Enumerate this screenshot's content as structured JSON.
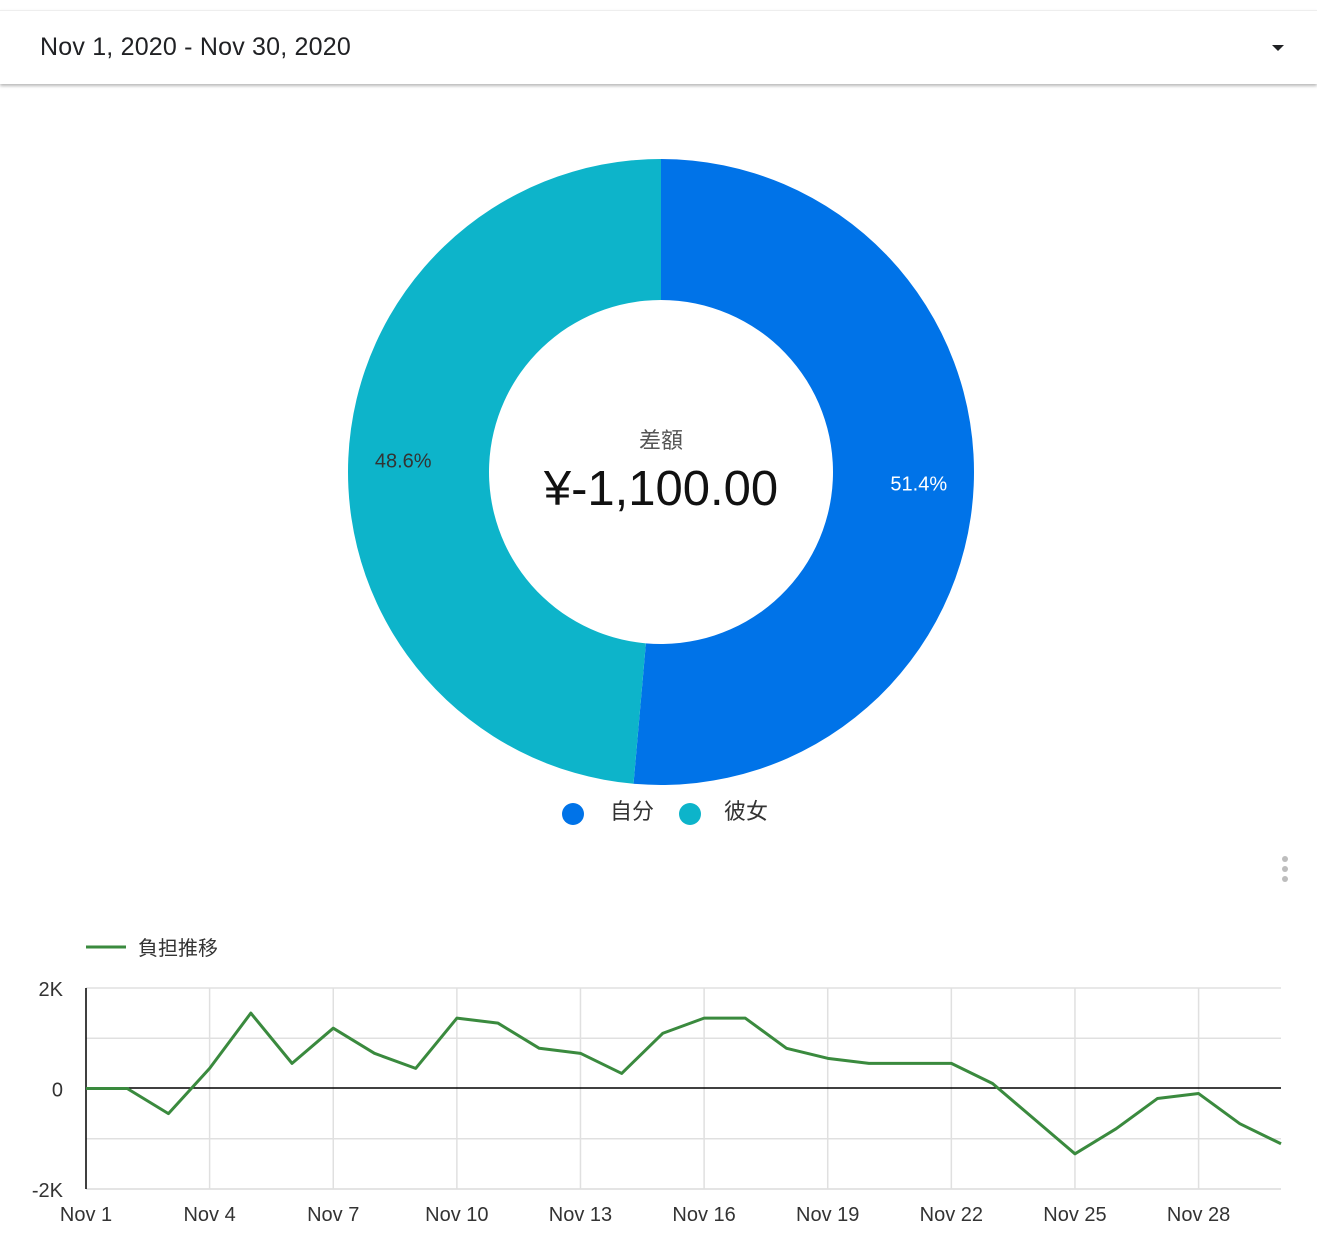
{
  "date_range": {
    "label": "Nov 1, 2020 - Nov 30, 2020"
  },
  "icons": {
    "dropdown": "arrow-drop-down-icon",
    "more": "more-vert-icon"
  },
  "chart_data": [
    {
      "type": "pie",
      "donut": true,
      "center_label": "差額",
      "center_value": "¥-1,100.00",
      "slices": [
        {
          "name": "自分",
          "value": 51.4,
          "label": "51.4%",
          "color": "#0073e8"
        },
        {
          "name": "彼女",
          "value": 48.6,
          "label": "48.6%",
          "color": "#0db4ca"
        }
      ],
      "legend": {
        "position": "bottom",
        "items": [
          "自分",
          "彼女"
        ]
      }
    },
    {
      "type": "line",
      "series": [
        {
          "name": "負担推移",
          "color": "#3a8a3e",
          "values": [
            0,
            0,
            -500,
            400,
            1500,
            500,
            1200,
            700,
            400,
            1400,
            1300,
            800,
            700,
            300,
            1100,
            1400,
            1400,
            800,
            600,
            500,
            500,
            500,
            100,
            -600,
            -1300,
            -800,
            -200,
            -100,
            -700,
            -1100
          ]
        }
      ],
      "x": [
        "Nov 1",
        "Nov 2",
        "Nov 3",
        "Nov 4",
        "Nov 5",
        "Nov 6",
        "Nov 7",
        "Nov 8",
        "Nov 9",
        "Nov 10",
        "Nov 11",
        "Nov 12",
        "Nov 13",
        "Nov 14",
        "Nov 15",
        "Nov 16",
        "Nov 17",
        "Nov 18",
        "Nov 19",
        "Nov 20",
        "Nov 21",
        "Nov 22",
        "Nov 23",
        "Nov 24",
        "Nov 25",
        "Nov 26",
        "Nov 27",
        "Nov 28",
        "Nov 29",
        "Nov 30"
      ],
      "x_tick_labels": [
        "Nov 1",
        "Nov 4",
        "Nov 7",
        "Nov 10",
        "Nov 13",
        "Nov 16",
        "Nov 19",
        "Nov 22",
        "Nov 25",
        "Nov 28"
      ],
      "y_tick_labels": [
        "2K",
        "0",
        "-2K"
      ],
      "ylim": [
        -2000,
        2000
      ],
      "grid": true,
      "legend": {
        "position": "top-left"
      }
    }
  ]
}
